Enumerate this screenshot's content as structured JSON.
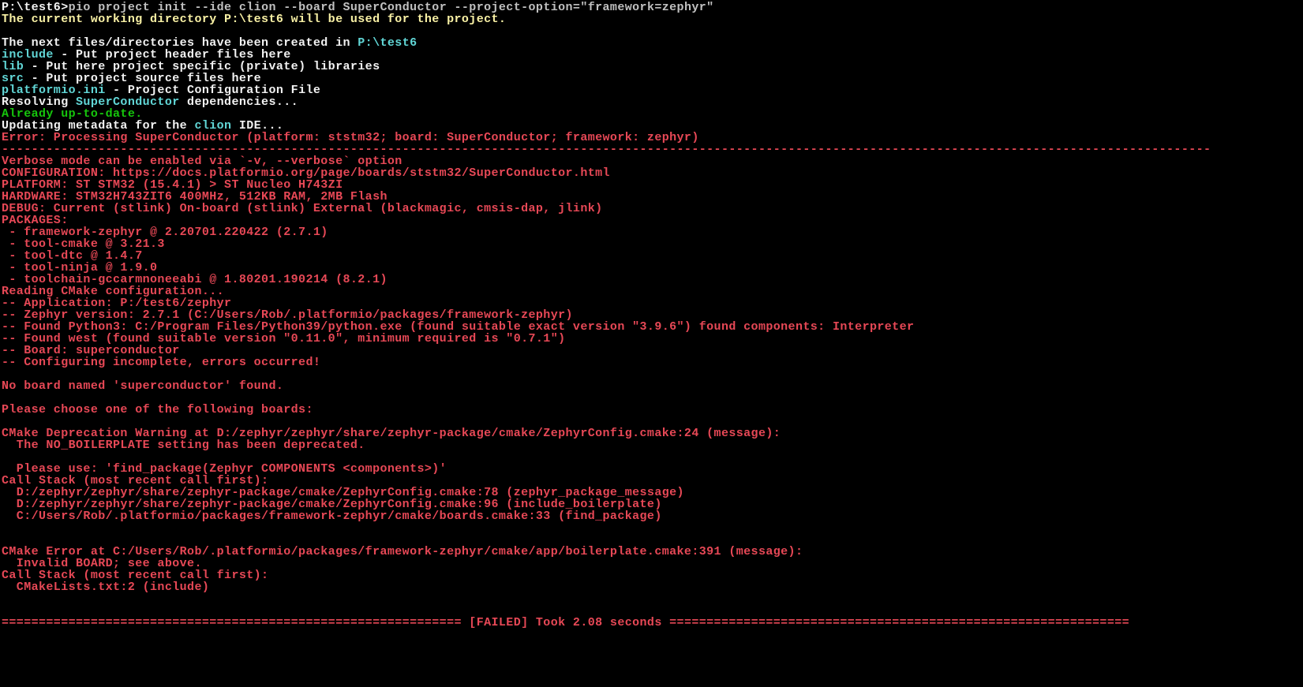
{
  "prompt": {
    "path": "P:\\test6>",
    "command": "pio project init --ide clion --board SuperConductor --project-option=\"framework=zephyr\""
  },
  "cwd_line": {
    "prefix": "The current working directory ",
    "path": "P:\\test6",
    "suffix": " will be used for the project."
  },
  "created": {
    "intro_prefix": "The next files/directories have been created in ",
    "intro_path": "P:\\test6",
    "include_key": "include",
    "include_desc": " - Put project header files here",
    "lib_key": "lib",
    "lib_desc": " - Put here project specific (private) libraries",
    "src_key": "src",
    "src_desc": " - Put project source files here",
    "ini_key": "platformio.ini",
    "ini_desc": " - Project Configuration File"
  },
  "resolving": {
    "prefix": "Resolving ",
    "board": "SuperConductor",
    "suffix": " dependencies..."
  },
  "already_up_to_date": "Already up-to-date.",
  "updating_metadata": {
    "prefix": "Updating metadata for the ",
    "ide": "clion",
    "suffix": " IDE..."
  },
  "error_processing": "Error: Processing SuperConductor (platform: ststm32; board: SuperConductor; framework: zephyr)",
  "dash_line1": "-------------------------------------------------------------------------------------------------------------------------------------------------------------------",
  "verbose_hint": "Verbose mode can be enabled via `-v, --verbose` option",
  "configuration_line": "CONFIGURATION: https://docs.platformio.org/page/boards/ststm32/SuperConductor.html",
  "platform_line": "PLATFORM: ST STM32 (15.4.1) > ST Nucleo H743ZI",
  "hardware_line": "HARDWARE: STM32H743ZIT6 400MHz, 512KB RAM, 2MB Flash",
  "debug_line": "DEBUG: Current (stlink) On-board (stlink) External (blackmagic, cmsis-dap, jlink)",
  "packages_header": "PACKAGES:",
  "packages": {
    "p1": " - framework-zephyr @ 2.20701.220422 (2.7.1)",
    "p2": " - tool-cmake @ 3.21.3",
    "p3": " - tool-dtc @ 1.4.7",
    "p4": " - tool-ninja @ 1.9.0",
    "p5": " - toolchain-gccarmnoneeabi @ 1.80201.190214 (8.2.1)"
  },
  "reading_cmake": "Reading CMake configuration...",
  "cmake": {
    "c1": "-- Application: P:/test6/zephyr",
    "c2": "-- Zephyr version: 2.7.1 (C:/Users/Rob/.platformio/packages/framework-zephyr)",
    "c3": "-- Found Python3: C:/Program Files/Python39/python.exe (found suitable exact version \"3.9.6\") found components: Interpreter",
    "c4": "-- Found west (found suitable version \"0.11.0\", minimum required is \"0.7.1\")",
    "c5": "-- Board: superconductor",
    "c6": "-- Configuring incomplete, errors occurred!"
  },
  "no_board": "No board named 'superconductor' found.",
  "choose_board": "Please choose one of the following boards:",
  "cmake_dep_warn": {
    "l1": "CMake Deprecation Warning at D:/zephyr/zephyr/share/zephyr-package/cmake/ZephyrConfig.cmake:24 (message):",
    "l2": "  The NO_BOILERPLATE setting has been deprecated.",
    "l3": "  Please use: 'find_package(Zephyr COMPONENTS <components>)'"
  },
  "call_stack1": {
    "h": "Call Stack (most recent call first):",
    "s1": "  D:/zephyr/zephyr/share/zephyr-package/cmake/ZephyrConfig.cmake:78 (zephyr_package_message)",
    "s2": "  D:/zephyr/zephyr/share/zephyr-package/cmake/ZephyrConfig.cmake:96 (include_boilerplate)",
    "s3": "  C:/Users/Rob/.platformio/packages/framework-zephyr/cmake/boards.cmake:33 (find_package)"
  },
  "cmake_error": {
    "l1": "CMake Error at C:/Users/Rob/.platformio/packages/framework-zephyr/cmake/app/boilerplate.cmake:391 (message):",
    "l2": "  Invalid BOARD; see above."
  },
  "call_stack2": {
    "h": "Call Stack (most recent call first):",
    "s1": "  CMakeLists.txt:2 (include)"
  },
  "failed_line": {
    "eq_left": "============================================================== ",
    "label": "[FAILED] Took 2.08 seconds",
    "eq_right": " =============================================================="
  }
}
